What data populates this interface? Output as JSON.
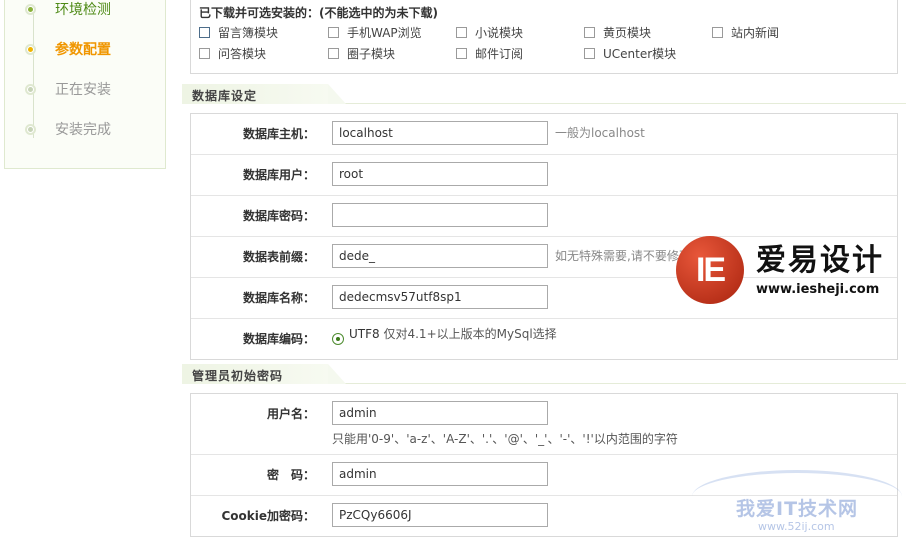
{
  "steps": [
    {
      "label": "环境检测",
      "state": "done"
    },
    {
      "label": "参数配置",
      "state": "active"
    },
    {
      "label": "正在安装",
      "state": "pending"
    },
    {
      "label": "安装完成",
      "state": "pending"
    }
  ],
  "modules": {
    "title": "已下载并可选安装的：(不能选中的为未下载)",
    "items": [
      {
        "label": "留言簿模块"
      },
      {
        "label": "手机WAP浏览"
      },
      {
        "label": "小说模块"
      },
      {
        "label": "黄页模块"
      },
      {
        "label": "站内新闻"
      },
      {
        "label": "问答模块"
      },
      {
        "label": "圈子模块"
      },
      {
        "label": "邮件订阅"
      },
      {
        "label": "UCenter模块"
      }
    ]
  },
  "db_section": {
    "title": "数据库设定",
    "host": {
      "label": "数据库主机：",
      "value": "localhost",
      "hint": "一般为localhost"
    },
    "user": {
      "label": "数据库用户：",
      "value": "root"
    },
    "password": {
      "label": "数据库密码：",
      "value": ""
    },
    "prefix": {
      "label": "数据表前缀：",
      "value": "dede_",
      "hint": "如无特殊需要,请不要修改"
    },
    "name": {
      "label": "数据库名称：",
      "value": "dedecmsv57utf8sp1"
    },
    "charset": {
      "label": "数据库编码：",
      "option": "UTF8",
      "note": "仅对4.1+以上版本的MySql选择"
    }
  },
  "admin_section": {
    "title": "管理员初始密码",
    "username": {
      "label": "用户名：",
      "value": "admin",
      "hint": "只能用'0-9'、'a-z'、'A-Z'、'.'、'@'、'_'、'-'、'!'以内范围的字符"
    },
    "password": {
      "label": "密　码：",
      "value": "admin"
    },
    "cookie": {
      "label": "Cookie加密码：",
      "value": "PzCQy6606J"
    }
  },
  "watermark": {
    "logo_letters": "IE",
    "brand": "爱易设计",
    "url": "www.iesheji.com",
    "site2_name": "我爱IT技术网",
    "site2_url": "www.52ij.com"
  }
}
